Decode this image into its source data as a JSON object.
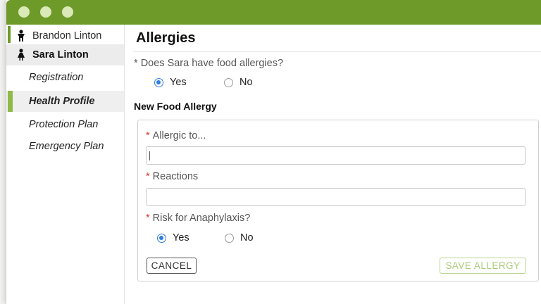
{
  "window": {
    "accent_color": "#6e9a29"
  },
  "sidebar": {
    "people": [
      {
        "name": "Brandon Linton",
        "icon": "child-boy-icon"
      },
      {
        "name": "Sara Linton",
        "icon": "child-girl-icon",
        "selected": true
      }
    ],
    "nav": [
      {
        "label": "Registration"
      },
      {
        "label": "Health Profile",
        "selected": true
      },
      {
        "label": "Protection Plan"
      },
      {
        "label": "Emergency Plan"
      }
    ]
  },
  "main": {
    "title": "Allergies",
    "question": {
      "required_mark": "*",
      "text": "Does Sara have food allergies?",
      "options": [
        "Yes",
        "No"
      ],
      "selected": "Yes"
    },
    "section_title": "New Food Allergy",
    "form": {
      "required_mark": "*",
      "allergic_to": {
        "label": "Allergic to...",
        "value": ""
      },
      "reactions": {
        "label": "Reactions",
        "value": ""
      },
      "anaphylaxis": {
        "label": "Risk for Anaphylaxis?",
        "options": [
          "Yes",
          "No"
        ],
        "selected": "Yes"
      },
      "cancel_label": "CANCEL",
      "save_label": "SAVE ALLERGY"
    }
  }
}
